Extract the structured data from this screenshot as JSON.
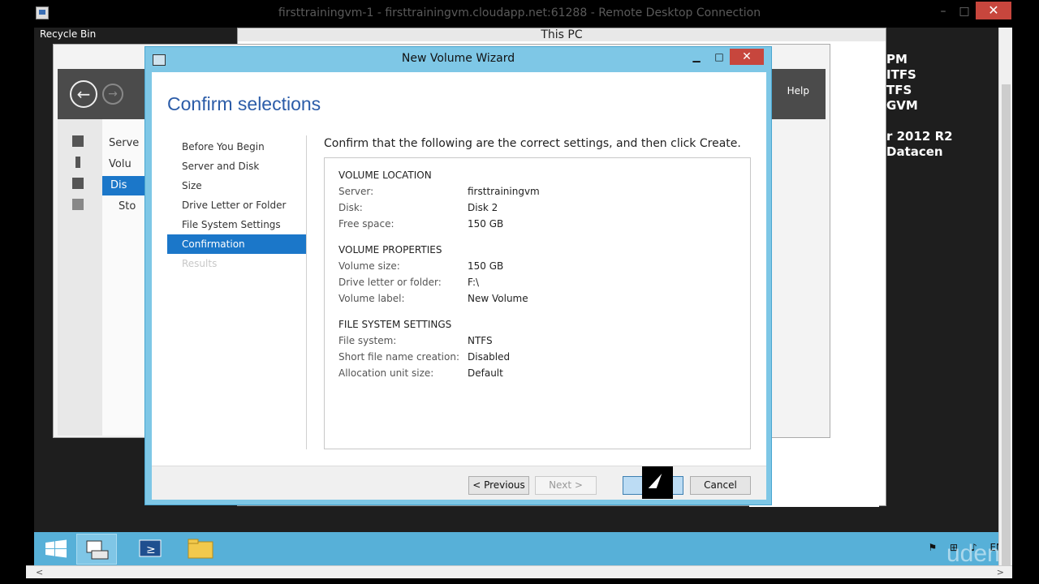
{
  "rdc": {
    "title": "firsttrainingvm-1 - firsttrainingvm.cloudapp.net:61288 - Remote Desktop Connection",
    "minimize": "–",
    "maximize": "□",
    "close": "✕"
  },
  "desktop": {
    "recycle_bin": "Recycle Bin",
    "bginfo_lines": [
      "PM",
      "ITFS",
      "TFS",
      "GVM",
      "r 2012 R2 Datacen"
    ]
  },
  "this_pc": {
    "title": "This PC"
  },
  "server_manager": {
    "help": "Help",
    "back_icon": "←",
    "forward_icon": "→",
    "items": [
      "Serve",
      "Volu",
      "Dis",
      "Sto"
    ]
  },
  "wizard": {
    "title": "New Volume Wizard",
    "minimize": "▁",
    "maximize": "□",
    "close": "✕",
    "heading": "Confirm selections",
    "steps": [
      {
        "label": "Before You Begin",
        "state": "normal"
      },
      {
        "label": "Server and Disk",
        "state": "normal"
      },
      {
        "label": "Size",
        "state": "normal"
      },
      {
        "label": "Drive Letter or Folder",
        "state": "normal"
      },
      {
        "label": "File System Settings",
        "state": "normal"
      },
      {
        "label": "Confirmation",
        "state": "active"
      },
      {
        "label": "Results",
        "state": "disabled"
      }
    ],
    "confirm_text": "Confirm that the following are the correct settings, and then click Create.",
    "sections": {
      "location": {
        "header": "VOLUME LOCATION",
        "server_label": "Server:",
        "server_value": "firsttrainingvm",
        "disk_label": "Disk:",
        "disk_value": "Disk 2",
        "free_label": "Free space:",
        "free_value": "150 GB"
      },
      "properties": {
        "header": "VOLUME PROPERTIES",
        "size_label": "Volume size:",
        "size_value": "150 GB",
        "drive_label": "Drive letter or folder:",
        "drive_value": "F:\\",
        "vlabel_label": "Volume label:",
        "vlabel_value": "New Volume"
      },
      "filesystem": {
        "header": "FILE SYSTEM SETTINGS",
        "fs_label": "File system:",
        "fs_value": "NTFS",
        "short_label": "Short file name creation:",
        "short_value": "Disabled",
        "alloc_label": "Allocation unit size:",
        "alloc_value": "Default"
      }
    },
    "buttons": {
      "previous": "< Previous",
      "next": "Next >",
      "create": "",
      "cancel": "Cancel"
    }
  },
  "taskbar": {
    "lang": "EN",
    "watermark": "udemy"
  }
}
